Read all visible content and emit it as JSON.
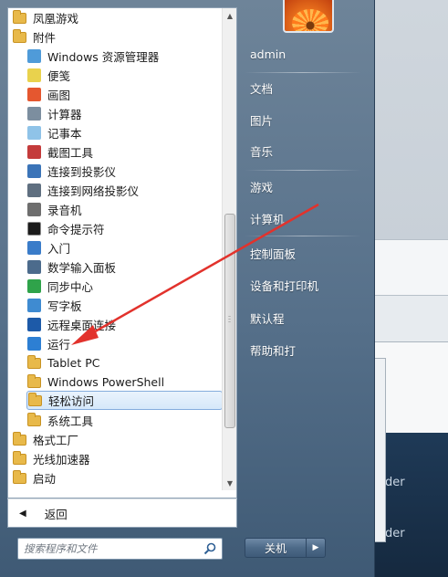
{
  "programs": [
    {
      "label": "凤凰游戏",
      "icon": "folder-icon",
      "level": 0,
      "highlight": false
    },
    {
      "label": "附件",
      "icon": "folder-icon",
      "level": 0,
      "highlight": false
    },
    {
      "label": "Windows 资源管理器",
      "icon": "explorer-icon",
      "level": 1,
      "highlight": false
    },
    {
      "label": "便笺",
      "icon": "sticky-notes-icon",
      "level": 1,
      "highlight": false
    },
    {
      "label": "画图",
      "icon": "paint-icon",
      "level": 1,
      "highlight": false
    },
    {
      "label": "计算器",
      "icon": "calculator-icon",
      "level": 1,
      "highlight": false
    },
    {
      "label": "记事本",
      "icon": "notepad-icon",
      "level": 1,
      "highlight": false
    },
    {
      "label": "截图工具",
      "icon": "snipping-tool-icon",
      "level": 1,
      "highlight": false
    },
    {
      "label": "连接到投影仪",
      "icon": "projector-icon",
      "level": 1,
      "highlight": false
    },
    {
      "label": "连接到网络投影仪",
      "icon": "network-projector-icon",
      "level": 1,
      "highlight": false
    },
    {
      "label": "录音机",
      "icon": "microphone-icon",
      "level": 1,
      "highlight": false
    },
    {
      "label": "命令提示符",
      "icon": "command-prompt-icon",
      "level": 1,
      "highlight": false
    },
    {
      "label": "入门",
      "icon": "getting-started-icon",
      "level": 1,
      "highlight": false
    },
    {
      "label": "数学输入面板",
      "icon": "math-input-icon",
      "level": 1,
      "highlight": false
    },
    {
      "label": "同步中心",
      "icon": "sync-center-icon",
      "level": 1,
      "highlight": false
    },
    {
      "label": "写字板",
      "icon": "wordpad-icon",
      "level": 1,
      "highlight": false
    },
    {
      "label": "远程桌面连接",
      "icon": "remote-desktop-icon",
      "level": 1,
      "highlight": false
    },
    {
      "label": "运行",
      "icon": "run-icon",
      "level": 1,
      "highlight": false
    },
    {
      "label": "Tablet PC",
      "icon": "folder-icon",
      "level": 1,
      "highlight": false
    },
    {
      "label": "Windows PowerShell",
      "icon": "folder-icon",
      "level": 1,
      "highlight": false
    },
    {
      "label": "轻松访问",
      "icon": "folder-icon",
      "level": 1,
      "highlight": true
    },
    {
      "label": "系统工具",
      "icon": "folder-icon",
      "level": 1,
      "highlight": false
    },
    {
      "label": "格式工厂",
      "icon": "folder-icon",
      "level": 0,
      "highlight": false
    },
    {
      "label": "光线加速器",
      "icon": "folder-icon",
      "level": 0,
      "highlight": false
    },
    {
      "label": "启动",
      "icon": "folder-icon",
      "level": 0,
      "highlight": false
    }
  ],
  "back": {
    "label": "返回"
  },
  "search": {
    "placeholder": "搜索程序和文件"
  },
  "right_menu": [
    {
      "label": "admin",
      "name": "user-admin"
    },
    {
      "label": "文档",
      "name": "documents"
    },
    {
      "label": "图片",
      "name": "pictures"
    },
    {
      "label": "音乐",
      "name": "music"
    },
    {
      "label": "游戏",
      "name": "games"
    },
    {
      "label": "计算机",
      "name": "computer"
    },
    {
      "label": "控制面板",
      "name": "control-panel"
    },
    {
      "label": "设备和打印机",
      "name": "devices-printers"
    },
    {
      "label": "默认程",
      "name": "default-programs"
    },
    {
      "label": "帮助和打",
      "name": "help-support"
    }
  ],
  "shutdown": {
    "label": "关机"
  },
  "background": {
    "dark_text_1": "der",
    "dark_text_2": "der"
  },
  "colors": {
    "annotation_arrow": "#e2322c",
    "highlight_border": "#84acdd"
  }
}
